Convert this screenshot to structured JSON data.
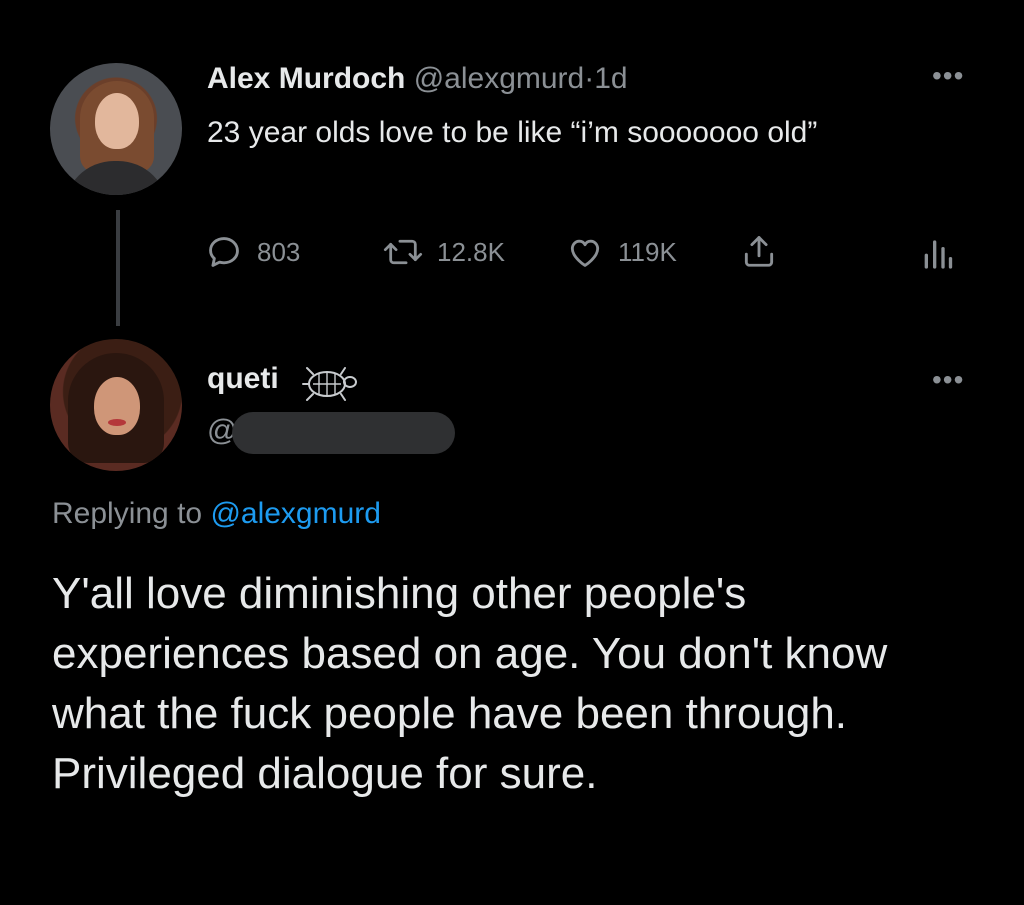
{
  "parent_tweet": {
    "author_name": "Alex Murdoch",
    "handle": "@alexgmurd",
    "separator": "·",
    "time": "1d",
    "more_icon": "ellipsis-icon",
    "text": "23 year olds love to be like “i’m sooooooo old”",
    "actions": {
      "reply": {
        "icon": "reply-bubble-icon",
        "count": "803"
      },
      "retweet": {
        "icon": "retweet-icon",
        "count": "12.8K"
      },
      "like": {
        "icon": "heart-icon",
        "count": "119K"
      },
      "share": {
        "icon": "share-icon"
      },
      "analytics": {
        "icon": "analytics-icon"
      }
    }
  },
  "reply_tweet": {
    "author_name": "queti",
    "name_emoji": "turtle-icon",
    "handle_prefix": "@",
    "handle_redacted": true,
    "more_icon": "ellipsis-icon",
    "replying_to_label": "Replying to",
    "replying_to_handle": "@alexgmurd",
    "text": "Y'all love diminishing other people's experiences based on age. You don't know what the fuck people have been through. Privileged dialogue for sure."
  },
  "colors": {
    "background": "#000000",
    "primary_text": "#e7e9ea",
    "secondary_text": "#8b9095",
    "link": "#1d9bf0",
    "thread_line": "#3a3d41"
  }
}
